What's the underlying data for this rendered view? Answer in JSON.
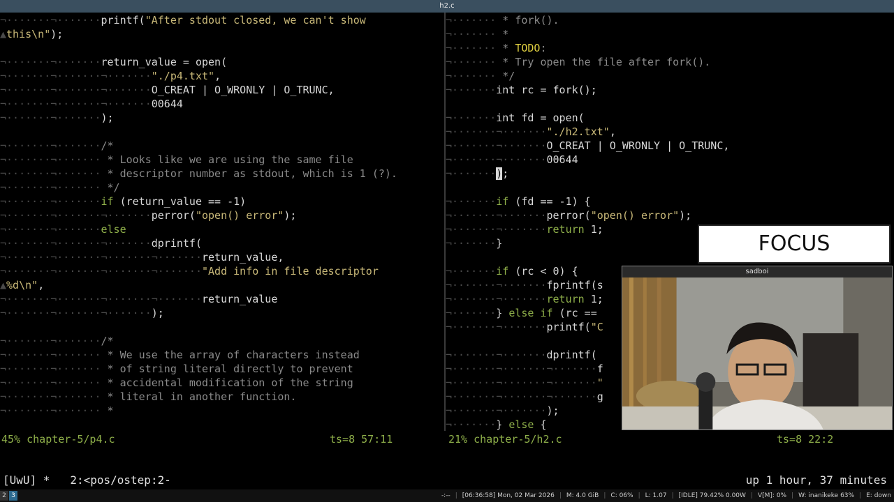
{
  "window": {
    "title": "h2.c"
  },
  "left_pane": {
    "lines": [
      [
        [
          "ws",
          "¬·······¬·······"
        ],
        [
          "code",
          "printf("
        ],
        [
          "str",
          "\"After stdout closed, we can't show"
        ]
      ],
      [
        [
          "ws",
          "▲"
        ],
        [
          "str",
          "this\\n\""
        ],
        [
          "code",
          ");"
        ]
      ],
      [],
      [
        [
          "ws",
          "¬·······¬·······"
        ],
        [
          "code",
          "return_value = open("
        ]
      ],
      [
        [
          "ws",
          "¬·······¬·······¬·······"
        ],
        [
          "str",
          "\"./p4.txt\""
        ],
        [
          "code",
          ","
        ]
      ],
      [
        [
          "ws",
          "¬·······¬·······¬·······"
        ],
        [
          "code",
          "O_CREAT | O_WRONLY | O_TRUNC,"
        ]
      ],
      [
        [
          "ws",
          "¬·······¬·······¬·······"
        ],
        [
          "code",
          "00644"
        ]
      ],
      [
        [
          "ws",
          "¬·······¬·······"
        ],
        [
          "code",
          ");"
        ]
      ],
      [],
      [
        [
          "ws",
          "¬·······¬·······"
        ],
        [
          "cmt",
          "/*"
        ]
      ],
      [
        [
          "ws",
          "¬·······¬······· "
        ],
        [
          "cmt",
          "* Looks like we are using the same file"
        ]
      ],
      [
        [
          "ws",
          "¬·······¬······· "
        ],
        [
          "cmt",
          "* descriptor number as stdout, which is 1 (?)."
        ]
      ],
      [
        [
          "ws",
          "¬·······¬······· "
        ],
        [
          "cmt",
          "*/"
        ]
      ],
      [
        [
          "ws",
          "¬·······¬·······"
        ],
        [
          "kw",
          "if"
        ],
        [
          "code",
          " (return_value == -1)"
        ]
      ],
      [
        [
          "ws",
          "¬·······¬·······¬·······"
        ],
        [
          "code",
          "perror("
        ],
        [
          "str",
          "\"open() error\""
        ],
        [
          "code",
          ");"
        ]
      ],
      [
        [
          "ws",
          "¬·······¬·······"
        ],
        [
          "kw",
          "else"
        ]
      ],
      [
        [
          "ws",
          "¬·······¬·······¬·······"
        ],
        [
          "code",
          "dprintf("
        ]
      ],
      [
        [
          "ws",
          "¬·······¬·······¬·······¬·······"
        ],
        [
          "code",
          "return_value,"
        ]
      ],
      [
        [
          "ws",
          "¬·······¬·······¬·······¬·······"
        ],
        [
          "str",
          "\"Add info in file descriptor"
        ]
      ],
      [
        [
          "ws",
          "▲"
        ],
        [
          "str",
          "%d\\n\""
        ],
        [
          "code",
          ","
        ]
      ],
      [
        [
          "ws",
          "¬·······¬·······¬·······¬·······"
        ],
        [
          "code",
          "return_value"
        ]
      ],
      [
        [
          "ws",
          "¬·······¬·······¬·······"
        ],
        [
          "code",
          ");"
        ]
      ],
      [],
      [
        [
          "ws",
          "¬·······¬·······"
        ],
        [
          "cmt",
          "/*"
        ]
      ],
      [
        [
          "ws",
          "¬·······¬······· "
        ],
        [
          "cmt",
          "* We use the array of characters instead"
        ]
      ],
      [
        [
          "ws",
          "¬·······¬······· "
        ],
        [
          "cmt",
          "* of string literal directly to prevent"
        ]
      ],
      [
        [
          "ws",
          "¬·······¬······· "
        ],
        [
          "cmt",
          "* accidental modification of the string"
        ]
      ],
      [
        [
          "ws",
          "¬·······¬······· "
        ],
        [
          "cmt",
          "* literal in another function."
        ]
      ],
      [
        [
          "ws",
          "¬·······¬······· "
        ],
        [
          "cmt",
          "*"
        ]
      ]
    ],
    "status_file": "45% chapter-5/p4.c",
    "status_pos": "ts=8 57:11"
  },
  "right_pane": {
    "lines": [
      [
        [
          "ws",
          "¬······· "
        ],
        [
          "cmt",
          "* fork()."
        ]
      ],
      [
        [
          "ws",
          "¬······· "
        ],
        [
          "cmt",
          "*"
        ]
      ],
      [
        [
          "ws",
          "¬······· "
        ],
        [
          "cmt",
          "* "
        ],
        [
          "todo",
          "TODO"
        ],
        [
          "cmt",
          ":"
        ]
      ],
      [
        [
          "ws",
          "¬······· "
        ],
        [
          "cmt",
          "* Try open the file after fork()."
        ]
      ],
      [
        [
          "ws",
          "¬······· "
        ],
        [
          "cmt",
          "*/"
        ]
      ],
      [
        [
          "ws",
          "¬·······"
        ],
        [
          "code",
          "int rc = fork();"
        ]
      ],
      [],
      [
        [
          "ws",
          "¬·······"
        ],
        [
          "code",
          "int fd = open("
        ]
      ],
      [
        [
          "ws",
          "¬·······¬·······"
        ],
        [
          "str",
          "\"./h2.txt\""
        ],
        [
          "code",
          ","
        ]
      ],
      [
        [
          "ws",
          "¬·······¬·······"
        ],
        [
          "code",
          "O_CREAT | O_WRONLY | O_TRUNC,"
        ]
      ],
      [
        [
          "ws",
          "¬·······¬·······"
        ],
        [
          "code",
          "00644"
        ]
      ],
      [
        [
          "ws",
          "¬·······"
        ],
        [
          "cursor",
          ")"
        ],
        [
          "code",
          ";"
        ]
      ],
      [],
      [
        [
          "ws",
          "¬·······"
        ],
        [
          "kw",
          "if"
        ],
        [
          "code",
          " (fd == -1) {"
        ]
      ],
      [
        [
          "ws",
          "¬·······¬·······"
        ],
        [
          "code",
          "perror("
        ],
        [
          "str",
          "\"open() error\""
        ],
        [
          "code",
          ");"
        ]
      ],
      [
        [
          "ws",
          "¬·······¬·······"
        ],
        [
          "kw",
          "return"
        ],
        [
          "code",
          " 1;"
        ]
      ],
      [
        [
          "ws",
          "¬·······"
        ],
        [
          "code",
          "}"
        ]
      ],
      [],
      [
        [
          "ws",
          "¬·······"
        ],
        [
          "kw",
          "if"
        ],
        [
          "code",
          " (rc < 0) {"
        ]
      ],
      [
        [
          "ws",
          "¬·······¬·······"
        ],
        [
          "code",
          "fprintf(s"
        ]
      ],
      [
        [
          "ws",
          "¬·······¬·······"
        ],
        [
          "kw",
          "return"
        ],
        [
          "code",
          " 1;"
        ]
      ],
      [
        [
          "ws",
          "¬·······"
        ],
        [
          "code",
          "} "
        ],
        [
          "kw",
          "else if"
        ],
        [
          "code",
          " (rc =="
        ]
      ],
      [
        [
          "ws",
          "¬·······¬·······"
        ],
        [
          "code",
          "printf("
        ],
        [
          "str",
          "\"C"
        ]
      ],
      [],
      [
        [
          "ws",
          "¬·······¬·······"
        ],
        [
          "code",
          "dprintf("
        ]
      ],
      [
        [
          "ws",
          "¬·······¬·······¬·······"
        ],
        [
          "code",
          "f"
        ]
      ],
      [
        [
          "ws",
          "¬·······¬·······¬·······"
        ],
        [
          "str",
          "\""
        ]
      ],
      [
        [
          "ws",
          "¬·······¬·······¬·······"
        ],
        [
          "code",
          "g"
        ]
      ],
      [
        [
          "ws",
          "¬·······¬·······"
        ],
        [
          "code",
          ");"
        ]
      ],
      [
        [
          "ws",
          "¬·······"
        ],
        [
          "code",
          "} "
        ],
        [
          "kw",
          "else"
        ],
        [
          "code",
          " {"
        ]
      ]
    ],
    "status_file": "21% chapter-5/h2.c",
    "status_pos": "ts=8 22:2"
  },
  "tmux": {
    "session": "[UwU] *",
    "window": "2:<pos/ostep:2-",
    "uptime": "up 1 hour, 37 minutes"
  },
  "wm_bar": {
    "workspaces": [
      "2",
      "3"
    ],
    "items": [
      "-:--",
      "|",
      "[06:36:58] Mon, 02 Mar 2026",
      "|",
      "M: 4.0 GiB",
      "|",
      "C: 06%",
      "|",
      "L: 1.07",
      "|",
      "[IDLE] 79.42% 0.00W",
      "|",
      "V[M]: 0%",
      "|",
      "W: inanikeke 63%",
      "|",
      "E: down"
    ]
  },
  "overlay": {
    "focus_label": "FOCUS",
    "camera_title": "sadboi"
  }
}
